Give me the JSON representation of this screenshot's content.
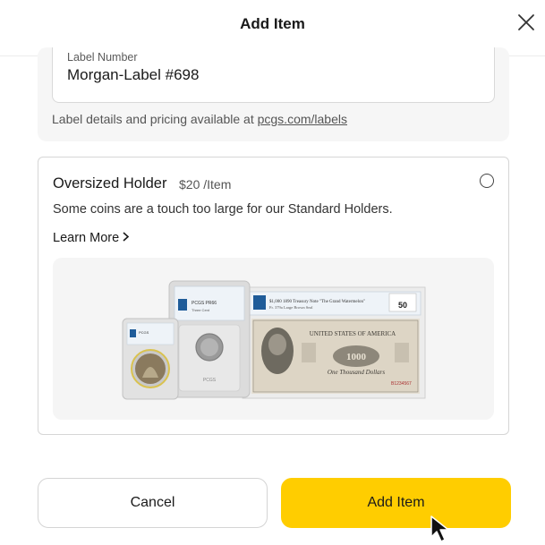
{
  "header": {
    "title": "Add Item"
  },
  "label_section": {
    "field_label": "Label Number",
    "field_value": "Morgan-Label #698",
    "note_text": "Label details and pricing available at ",
    "note_link": "pcgs.com/labels"
  },
  "option": {
    "title": "Oversized Holder",
    "price": "$20 /Item",
    "description": "Some coins are a touch too large for our Standard Holders.",
    "learn_more": "Learn More",
    "selected": false,
    "image": {
      "holder_small_grade": "PCGS",
      "holder_large_grade": "PCGS PR66",
      "banknote_grade": "50",
      "banknote_header": "UNITED STATES OF AMERICA",
      "banknote_denomination": "1000",
      "banknote_text": "One Thousand Dollars"
    }
  },
  "footer": {
    "cancel_label": "Cancel",
    "add_label": "Add Item"
  },
  "colors": {
    "accent": "#ffcd00",
    "panel_bg": "#f6f6f6",
    "border": "#d6d6d6"
  }
}
